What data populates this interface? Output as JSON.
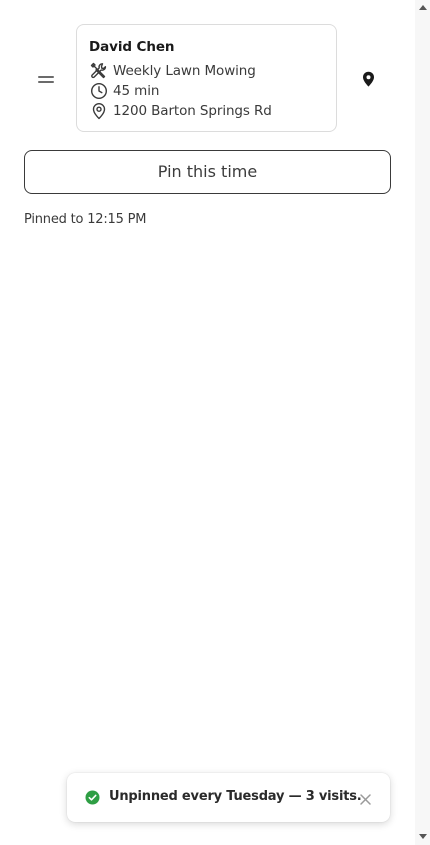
{
  "job": {
    "customer_name": "David Chen",
    "service": "Weekly Lawn Mowing",
    "duration": "45 min",
    "address": "1200 Barton Springs Rd"
  },
  "actions": {
    "pin_label": "Pin this time"
  },
  "status": {
    "pinned_text": "Pinned to 12:15 PM"
  },
  "toast": {
    "message": "Unpinned every Tuesday — 3 visits."
  },
  "colors": {
    "success": "#2e9e44",
    "icon": "#3a3a3a",
    "pin": "#1a1a1a"
  },
  "icons": {
    "service": "tools-icon",
    "duration": "clock-icon",
    "address": "location-icon",
    "map": "map-pin-icon",
    "handle": "drag-handle-icon",
    "toast_status": "check-circle-icon",
    "toast_dismiss": "close-icon"
  }
}
